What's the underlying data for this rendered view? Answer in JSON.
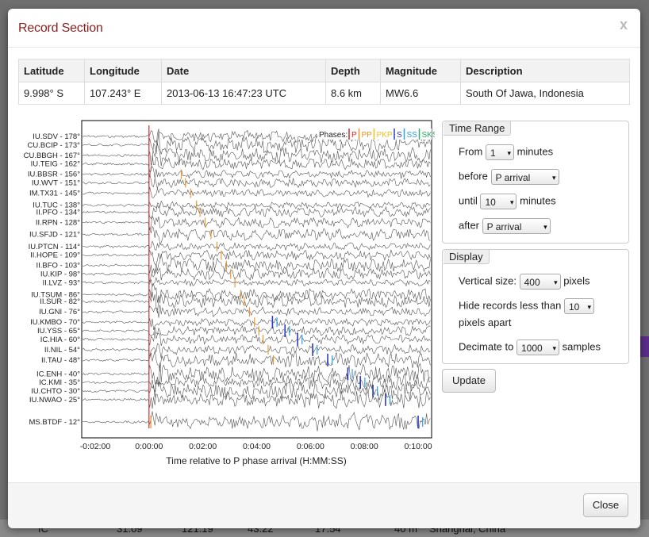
{
  "modal": {
    "title": "Record Section",
    "close_x": "x",
    "close_button": "Close"
  },
  "event_table": {
    "headers": [
      "Latitude",
      "Longitude",
      "Date",
      "Depth",
      "Magnitude",
      "Description"
    ],
    "row": [
      "9.998° S",
      "107.243° E",
      "2013-06-13 16:47:23 UTC",
      "8.6 km",
      "MW6.6",
      "South Of Jawa, Indonesia"
    ]
  },
  "plot": {
    "phases_label": "Phases:",
    "phases": [
      {
        "name": "P",
        "color": "#d22a2a"
      },
      {
        "name": "PP",
        "color": "#f0901e"
      },
      {
        "name": "PKP",
        "color": "#f0c020"
      },
      {
        "name": "S",
        "color": "#2a3ac8"
      },
      {
        "name": "SS",
        "color": "#29a0e0"
      },
      {
        "name": "SKS",
        "color": "#2ab060"
      }
    ],
    "stations": [
      "IU.SDV - 178°",
      "CU.BCIP - 173°",
      "CU.BBGH - 167°",
      "IU.TEIG - 162°",
      "IU.BBSR - 156°",
      "IU.WVT - 151°",
      "IM.TX31 - 145°",
      "IU.TUC - 138°",
      "II.PFO - 134°",
      "II.RPN - 128°",
      "IU.SFJD - 121°",
      "IU.PTCN - 114°",
      "II.HOPE - 109°",
      "II.BFO - 103°",
      "IU.KIP - 98°",
      "II.LVZ - 93°",
      "IU.TSUM - 86°",
      "II.SUR - 82°",
      "IU.GNI - 76°",
      "IU.KMBO - 70°",
      "IU.YSS - 65°",
      "IC.HIA - 60°",
      "II.NIL - 54°",
      "II.TAU - 48°",
      "IC.ENH - 40°",
      "IC.KMI - 35°",
      "IU.CHTO - 30°",
      "IU.NWAO - 25°",
      "MS.BTDF - 12°"
    ],
    "x_ticks": [
      "-0:02:00",
      "0:00:00",
      "0:02:00",
      "0:04:00",
      "0:06:00",
      "0:08:00",
      "0:10:00"
    ],
    "x_label": "Time relative to P phase arrival (H:MM:SS)"
  },
  "time_range": {
    "legend": "Time Range",
    "from_label": "From",
    "from_value": "1",
    "from_unit": "minutes",
    "before_label": "before",
    "before_value": "P arrival",
    "until_label": "until",
    "until_value": "10",
    "until_unit": "minutes",
    "after_label": "after",
    "after_value": "P arrival"
  },
  "display": {
    "legend": "Display",
    "vsize_label": "Vertical size:",
    "vsize_value": "400",
    "vsize_unit": "pixels",
    "hide_label": "Hide records less than",
    "hide_value": "10",
    "hide_unit": "pixels apart",
    "decimate_label": "Decimate to",
    "decimate_value": "1000",
    "decimate_unit": "samples"
  },
  "update_button": "Update",
  "background": {
    "bottom_row": [
      "IC",
      "31.09°",
      "121.19°",
      "43.22°",
      "17.54°",
      "40 m",
      "Shanghai, China"
    ]
  }
}
